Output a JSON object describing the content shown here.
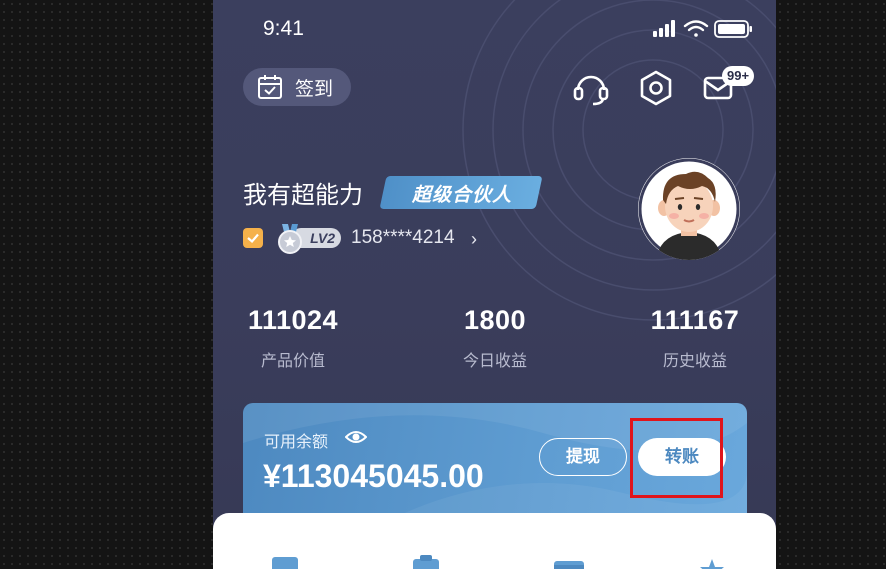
{
  "status_bar": {
    "time": "9:41"
  },
  "header": {
    "checkin_label": "签到",
    "message_badge": "99+"
  },
  "profile": {
    "username": "我有超能力",
    "tag": "超级合伙人",
    "level": "LV2",
    "phone": "158****4214",
    "phone_arrow": "›"
  },
  "stats": [
    {
      "value": "111024",
      "label": "产品价值"
    },
    {
      "value": "1800",
      "label": "今日收益"
    },
    {
      "value": "111167",
      "label": "历史收益"
    }
  ],
  "balance_card": {
    "label": "可用余额",
    "amount": "¥113045045.00",
    "withdraw_label": "提现",
    "transfer_label": "转账"
  },
  "colors": {
    "background": "#3b3f5e",
    "card": "#5f9dd2",
    "badge_check": "#f5b14a",
    "highlight": "#e0141b"
  },
  "icons": [
    "calendar-check-icon",
    "headset-icon",
    "settings-hexagon-icon",
    "mail-icon",
    "eye-icon",
    "signal-icon",
    "wifi-icon",
    "battery-icon"
  ]
}
